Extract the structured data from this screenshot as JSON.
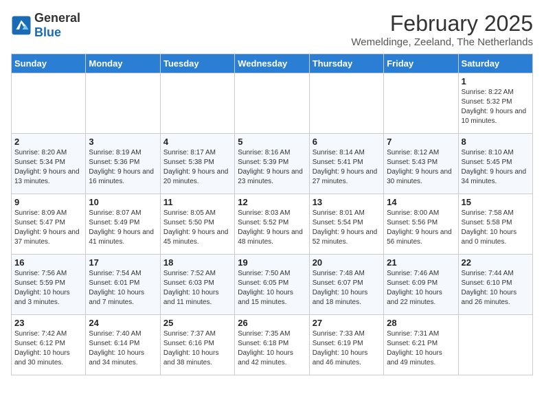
{
  "header": {
    "logo_general": "General",
    "logo_blue": "Blue",
    "month_year": "February 2025",
    "location": "Wemeldinge, Zeeland, The Netherlands"
  },
  "weekdays": [
    "Sunday",
    "Monday",
    "Tuesday",
    "Wednesday",
    "Thursday",
    "Friday",
    "Saturday"
  ],
  "weeks": [
    [
      {
        "day": "",
        "info": ""
      },
      {
        "day": "",
        "info": ""
      },
      {
        "day": "",
        "info": ""
      },
      {
        "day": "",
        "info": ""
      },
      {
        "day": "",
        "info": ""
      },
      {
        "day": "",
        "info": ""
      },
      {
        "day": "1",
        "info": "Sunrise: 8:22 AM\nSunset: 5:32 PM\nDaylight: 9 hours and 10 minutes."
      }
    ],
    [
      {
        "day": "2",
        "info": "Sunrise: 8:20 AM\nSunset: 5:34 PM\nDaylight: 9 hours and 13 minutes."
      },
      {
        "day": "3",
        "info": "Sunrise: 8:19 AM\nSunset: 5:36 PM\nDaylight: 9 hours and 16 minutes."
      },
      {
        "day": "4",
        "info": "Sunrise: 8:17 AM\nSunset: 5:38 PM\nDaylight: 9 hours and 20 minutes."
      },
      {
        "day": "5",
        "info": "Sunrise: 8:16 AM\nSunset: 5:39 PM\nDaylight: 9 hours and 23 minutes."
      },
      {
        "day": "6",
        "info": "Sunrise: 8:14 AM\nSunset: 5:41 PM\nDaylight: 9 hours and 27 minutes."
      },
      {
        "day": "7",
        "info": "Sunrise: 8:12 AM\nSunset: 5:43 PM\nDaylight: 9 hours and 30 minutes."
      },
      {
        "day": "8",
        "info": "Sunrise: 8:10 AM\nSunset: 5:45 PM\nDaylight: 9 hours and 34 minutes."
      }
    ],
    [
      {
        "day": "9",
        "info": "Sunrise: 8:09 AM\nSunset: 5:47 PM\nDaylight: 9 hours and 37 minutes."
      },
      {
        "day": "10",
        "info": "Sunrise: 8:07 AM\nSunset: 5:49 PM\nDaylight: 9 hours and 41 minutes."
      },
      {
        "day": "11",
        "info": "Sunrise: 8:05 AM\nSunset: 5:50 PM\nDaylight: 9 hours and 45 minutes."
      },
      {
        "day": "12",
        "info": "Sunrise: 8:03 AM\nSunset: 5:52 PM\nDaylight: 9 hours and 48 minutes."
      },
      {
        "day": "13",
        "info": "Sunrise: 8:01 AM\nSunset: 5:54 PM\nDaylight: 9 hours and 52 minutes."
      },
      {
        "day": "14",
        "info": "Sunrise: 8:00 AM\nSunset: 5:56 PM\nDaylight: 9 hours and 56 minutes."
      },
      {
        "day": "15",
        "info": "Sunrise: 7:58 AM\nSunset: 5:58 PM\nDaylight: 10 hours and 0 minutes."
      }
    ],
    [
      {
        "day": "16",
        "info": "Sunrise: 7:56 AM\nSunset: 5:59 PM\nDaylight: 10 hours and 3 minutes."
      },
      {
        "day": "17",
        "info": "Sunrise: 7:54 AM\nSunset: 6:01 PM\nDaylight: 10 hours and 7 minutes."
      },
      {
        "day": "18",
        "info": "Sunrise: 7:52 AM\nSunset: 6:03 PM\nDaylight: 10 hours and 11 minutes."
      },
      {
        "day": "19",
        "info": "Sunrise: 7:50 AM\nSunset: 6:05 PM\nDaylight: 10 hours and 15 minutes."
      },
      {
        "day": "20",
        "info": "Sunrise: 7:48 AM\nSunset: 6:07 PM\nDaylight: 10 hours and 18 minutes."
      },
      {
        "day": "21",
        "info": "Sunrise: 7:46 AM\nSunset: 6:09 PM\nDaylight: 10 hours and 22 minutes."
      },
      {
        "day": "22",
        "info": "Sunrise: 7:44 AM\nSunset: 6:10 PM\nDaylight: 10 hours and 26 minutes."
      }
    ],
    [
      {
        "day": "23",
        "info": "Sunrise: 7:42 AM\nSunset: 6:12 PM\nDaylight: 10 hours and 30 minutes."
      },
      {
        "day": "24",
        "info": "Sunrise: 7:40 AM\nSunset: 6:14 PM\nDaylight: 10 hours and 34 minutes."
      },
      {
        "day": "25",
        "info": "Sunrise: 7:37 AM\nSunset: 6:16 PM\nDaylight: 10 hours and 38 minutes."
      },
      {
        "day": "26",
        "info": "Sunrise: 7:35 AM\nSunset: 6:18 PM\nDaylight: 10 hours and 42 minutes."
      },
      {
        "day": "27",
        "info": "Sunrise: 7:33 AM\nSunset: 6:19 PM\nDaylight: 10 hours and 46 minutes."
      },
      {
        "day": "28",
        "info": "Sunrise: 7:31 AM\nSunset: 6:21 PM\nDaylight: 10 hours and 49 minutes."
      },
      {
        "day": "",
        "info": ""
      }
    ]
  ]
}
